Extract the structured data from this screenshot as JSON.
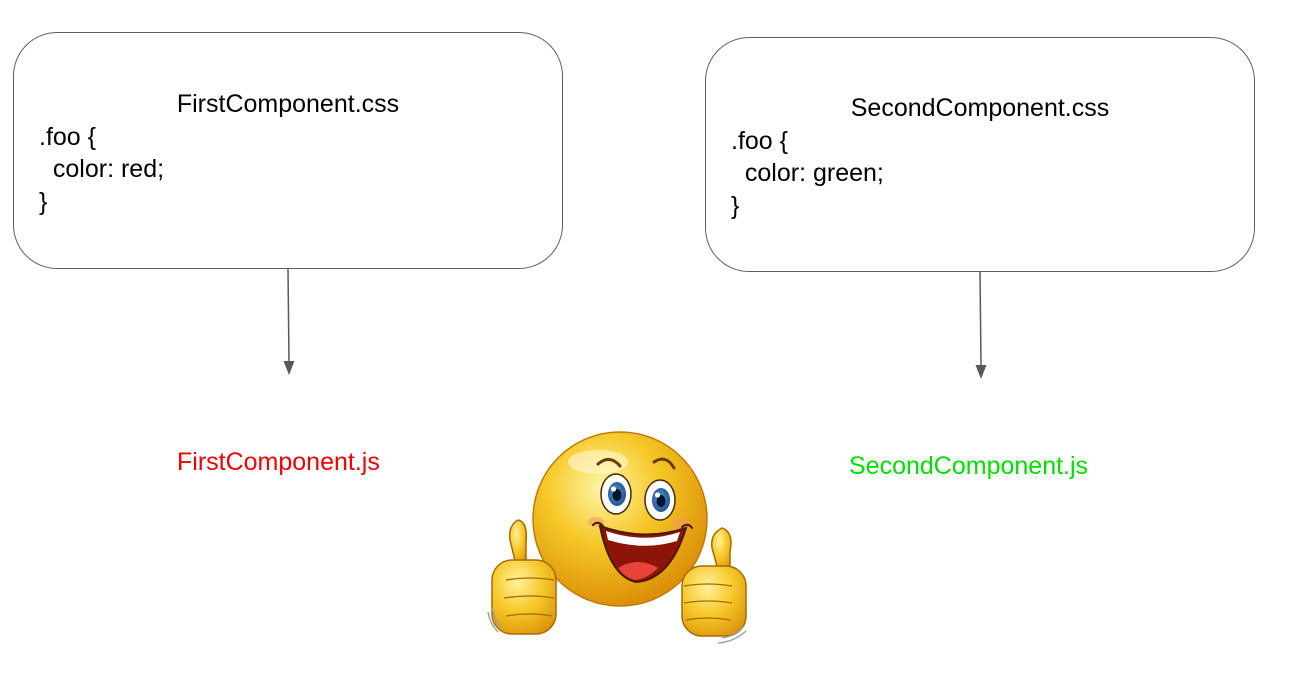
{
  "first": {
    "filename": "FirstComponent.css",
    "code": [
      ".foo {",
      "  color: red;",
      "}"
    ],
    "js_label": "FirstComponent.js",
    "js_color": "#ee0000"
  },
  "second": {
    "filename": "SecondComponent.css",
    "code": [
      ".foo {",
      "  color: green;",
      "}"
    ],
    "js_label": "SecondComponent.js",
    "js_color": "#00dd00"
  },
  "colors": {
    "box_border": "#5f5f5f",
    "arrow": "#595959",
    "face": "#f2b418"
  },
  "icons": {
    "smiley": "thumbs-up-smiley-icon"
  }
}
